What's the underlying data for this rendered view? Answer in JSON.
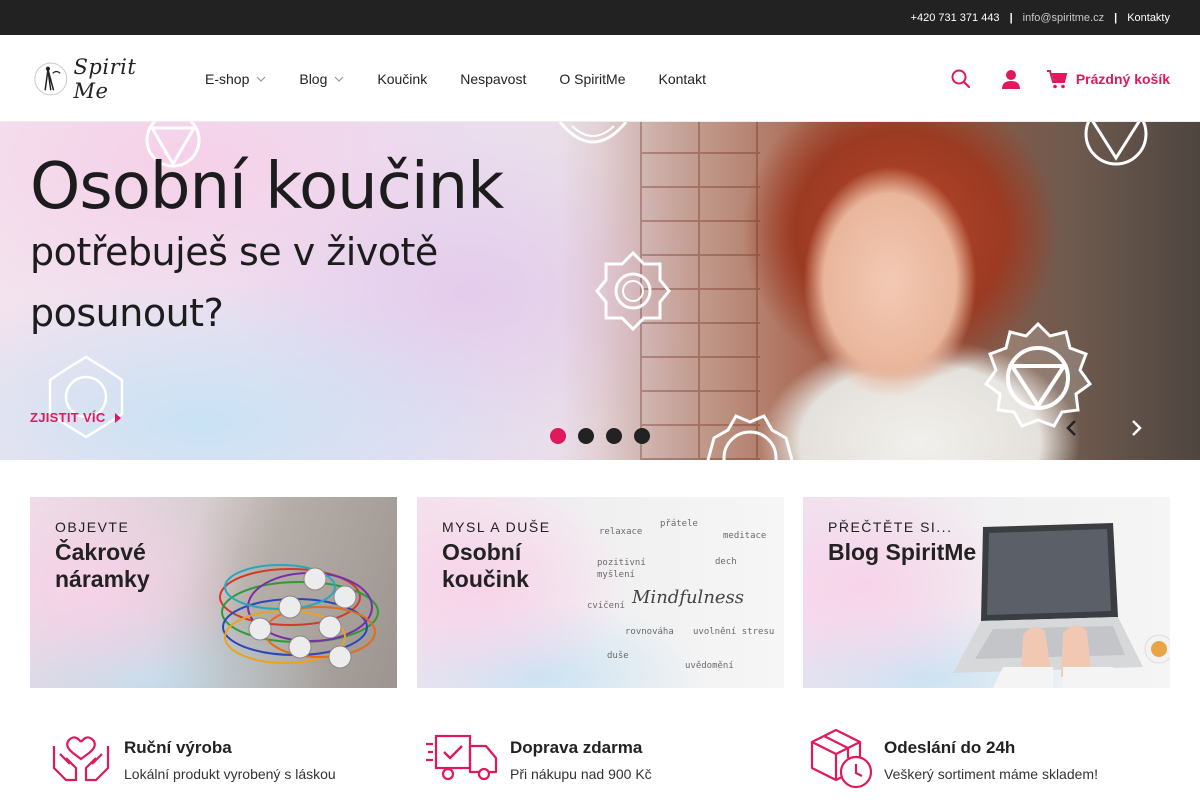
{
  "topbar": {
    "phone": "+420 731 371 443",
    "email": "info@spiritme.cz",
    "contacts": "Kontakty"
  },
  "header": {
    "logo_text": "Spirit Me",
    "nav": [
      {
        "label": "E-shop",
        "has_dropdown": true
      },
      {
        "label": "Blog",
        "has_dropdown": true
      },
      {
        "label": "Koučink",
        "has_dropdown": false
      },
      {
        "label": "Nespavost",
        "has_dropdown": false
      },
      {
        "label": "O SpiritMe",
        "has_dropdown": false
      },
      {
        "label": "Kontakt",
        "has_dropdown": false
      }
    ],
    "cart_label": "Prázdný košík",
    "icons": {
      "search": "search-icon",
      "user": "user-icon",
      "cart": "cart-icon"
    }
  },
  "hero": {
    "title": "Osobní koučink",
    "subtitle": "potřebuješ se v životě posunout?",
    "cta": "ZJISTIT VÍC",
    "slides_count": 4,
    "active_slide": 1
  },
  "tiles": [
    {
      "kicker": "OBJEVTE",
      "title": "Čakrové náramky"
    },
    {
      "kicker": "MYSL A DUŠE",
      "title": "Osobní koučink"
    },
    {
      "kicker": "PŘEČTĚTE SI...",
      "title": "Blog SpiritMe"
    }
  ],
  "mindfulness_words": {
    "main": "Mindfulness",
    "words": [
      "relaxace",
      "přátele",
      "meditace",
      "pozitivní myšlení",
      "dech",
      "cvičení",
      "rovnováha",
      "uvolnění stresu",
      "duše",
      "uvědomění"
    ]
  },
  "features": [
    {
      "title": "Ruční výroba",
      "desc": "Lokální produkt vyrobený s láskou",
      "icon": "hands-heart-icon"
    },
    {
      "title": "Doprava zdarma",
      "desc": "Při nákupu nad 900 Kč",
      "icon": "delivery-truck-icon"
    },
    {
      "title": "Odeslání do 24h",
      "desc": "Veškerý sortiment máme skladem!",
      "icon": "package-clock-icon"
    }
  ],
  "colors": {
    "accent": "#e0195c",
    "topbar": "#222222",
    "text": "#222222"
  }
}
